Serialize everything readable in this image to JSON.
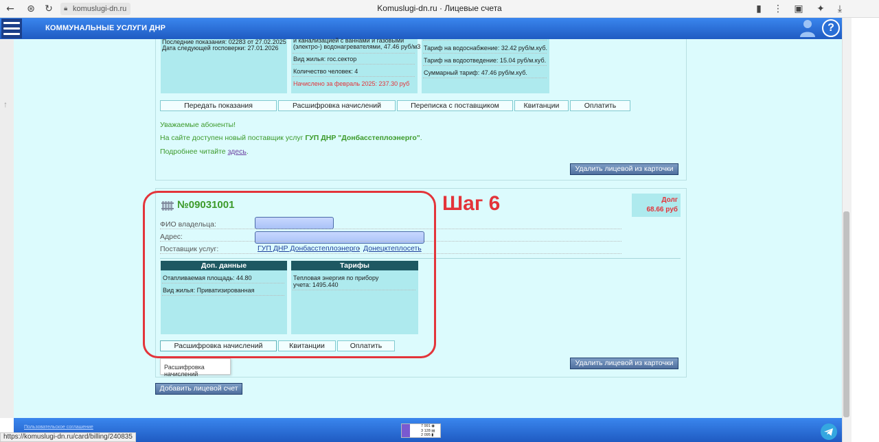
{
  "browser": {
    "url": "komuslugi-dn.ru",
    "tab_title": "Komuslugi-dn.ru · Лицевые счета",
    "status_url": "https://komuslugi-dn.ru/card/billing/240835"
  },
  "header": {
    "app_name": "КОММУНАЛЬНЫЕ УСЛУГИ ДНР",
    "help_symbol": "?"
  },
  "account1": {
    "meter_lines": [
      "Последние показания: 02283 от 27.02.2025",
      "Дата следующей госповерки: 27.01.2026"
    ],
    "info_lines": [
      "и канализацией с ваннами и газовыми",
      "(электро-) водонагревателями, 47.46 руб/м3"
    ],
    "housing": "Вид жилья: гос.сектор",
    "people": "Количество человек: 4",
    "charged": "Начислено за февраль 2025: 237.30 руб",
    "tariffs": [
      "Тариф на водоснабжение: 32.42 руб/м.куб.",
      "Тариф на водоотведение: 15.04 руб/м.куб.",
      "Суммарный тариф: 47.46 руб/м.куб."
    ],
    "buttons": {
      "submit_readings": "Передать показания",
      "charges": "Расшифровка начислений",
      "correspondence": "Переписка с поставщиком",
      "receipts": "Квитанции",
      "pay": "Оплатить"
    },
    "notice": {
      "greeting": "Уважаемые абоненты!",
      "line2_pre": "На сайте доступен новый поставщик услуг ",
      "line2_bold": "ГУП ДНР \"Донбасстеплоэнерго\"",
      "line2_post": ".",
      "line3_pre": "Подробнее читайте ",
      "line3_link": "здесь",
      "line3_post": "."
    },
    "delete_button": "Удалить лицевой из карточки"
  },
  "account2": {
    "number": "№09031001",
    "owner_label": "ФИО владельца:",
    "address_label": "Адрес:",
    "provider_label": "Поставщик услуг:",
    "provider_link": "ГУП ДНР Донбасстеплоэнерго",
    "provider_sep": "-",
    "provider_link2": "Донецктеплосеть",
    "debt_label": "Долг",
    "debt_value": "68.66 руб",
    "extra_header": "Доп. данные",
    "extra_area": "Отапливаемая площадь: 44.80",
    "extra_housing": "Вид жилья: Приватизированная",
    "tariff_header": "Тарифы",
    "tariff_text": "Тепловая энергия по прибору учета: 1495.440",
    "buttons": {
      "charges": "Расшифровка начислений",
      "receipts": "Квитанции",
      "pay": "Оплатить"
    },
    "delete_button": "Удалить лицевой из карточки",
    "tooltip": "Расшифровка начислений"
  },
  "annotation": "Шаг 6",
  "add_account_button": "Добавить лицевой счет",
  "footer": {
    "agreement_link": "Пользовательское соглашение",
    "counter_lines": [
      "7 991 ◉",
      "3 128 ▤",
      "2 095 ▮"
    ]
  },
  "colors": {
    "page_bg": "#dcfbfd",
    "header_blue": "#2a6fd6",
    "accent_red": "#e3343a",
    "green_text": "#3c9a2a"
  }
}
